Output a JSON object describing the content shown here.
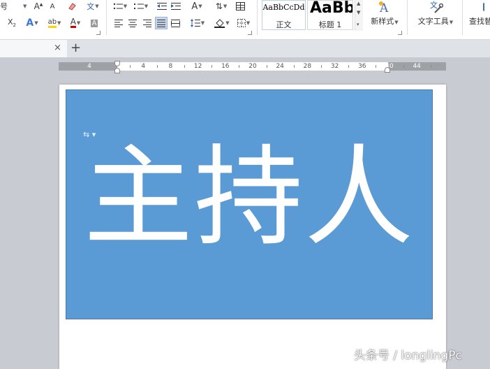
{
  "ribbon": {
    "font_size_label": "号",
    "styles": {
      "normal": {
        "sample": "AaBbCcDd",
        "name": "正文"
      },
      "heading1": {
        "sample": "AaBb",
        "name": "标题 1"
      }
    },
    "new_style_label": "新样式",
    "text_tools_label": "文字工具",
    "find_replace_label": "查找替"
  },
  "tabbar": {
    "close_glyph": "×",
    "new_tab_glyph": "+"
  },
  "ruler": {
    "left_numbers": [
      "4"
    ],
    "numbers": [
      "4",
      "8",
      "12",
      "16",
      "20",
      "24",
      "28",
      "32",
      "36",
      "40",
      "44"
    ]
  },
  "document": {
    "main_text": "主持人",
    "paragraph_mark": "⇆ ▾"
  },
  "watermark": "头条号 / longlingPc",
  "colors": {
    "box_fill": "#5b9bd5",
    "text": "#ffffff",
    "workspace": "#c8ccd2",
    "ruler": "#9ea1a6"
  }
}
